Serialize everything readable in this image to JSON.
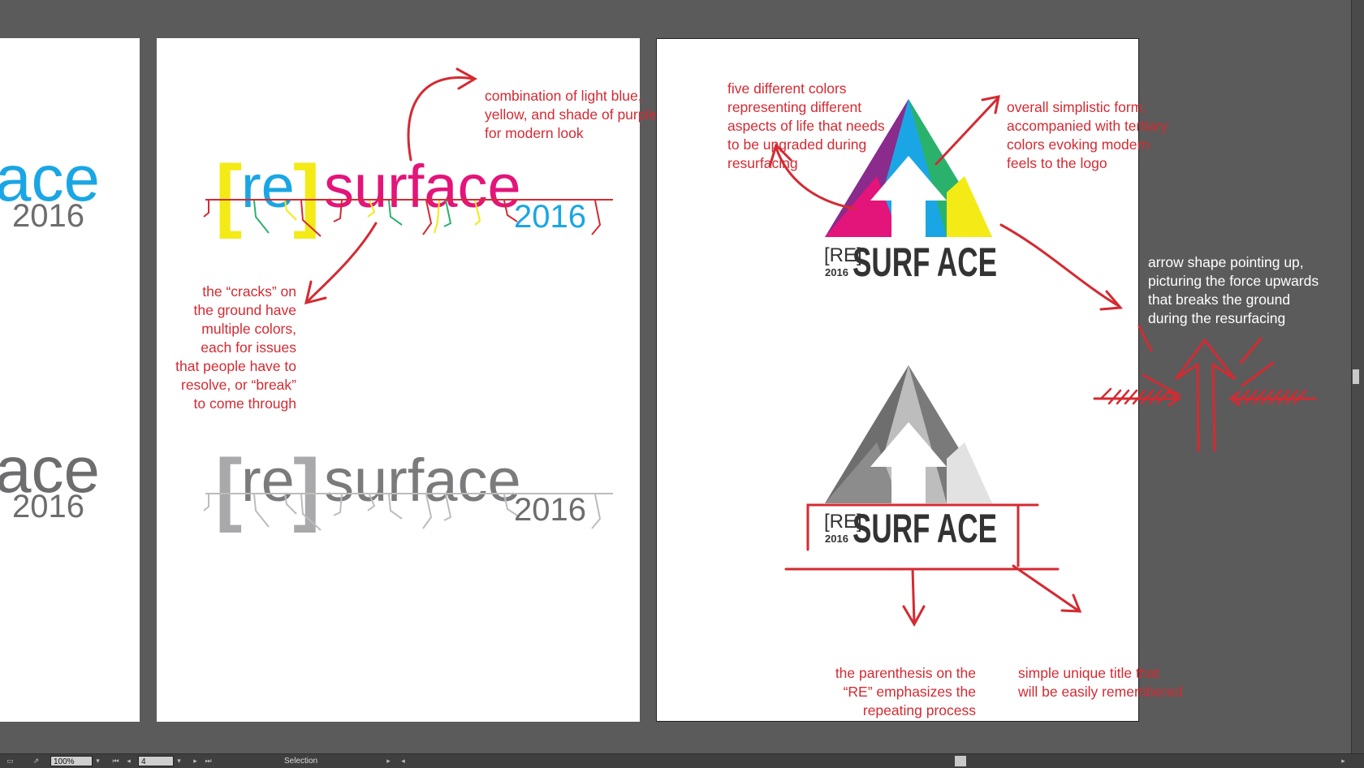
{
  "artboard1": {
    "word_partial": "ace",
    "year_top": "2016",
    "year_bottom": "2016"
  },
  "artboard2": {
    "logo_color": {
      "bracket_left": "[",
      "re": "re",
      "bracket_right": "]",
      "surface": "surface",
      "year": "2016"
    },
    "logo_gray": {
      "bracket_left": "[",
      "re": "re",
      "bracket_right": "]",
      "surface": "surface",
      "year": "2016"
    },
    "note_colors": [
      "combination of light blue,",
      "yellow, and shade of purple",
      "for modern look"
    ],
    "note_cracks": [
      "the “cracks” on",
      "the ground have",
      "multiple colors,",
      "each for issues",
      "that people have to",
      "resolve, or “break”",
      "to come through"
    ]
  },
  "artboard3": {
    "logo_color": {
      "re": "[RE]",
      "year": "2016",
      "title": "SURF ACE"
    },
    "logo_gray": {
      "re": "[RE]",
      "year": "2016",
      "title": "SURF ACE"
    },
    "note_five": [
      "five different colors",
      "representing different",
      "aspects of life that needs",
      "to be upgraded during",
      "resurfacing"
    ],
    "note_form": [
      "overall simplistic form,",
      "accompanied with tertiary",
      "colors evoking modern",
      "feels to the logo"
    ],
    "note_paren": [
      "the parenthesis on the",
      "“RE” emphasizes the",
      "repeating process"
    ],
    "note_title": [
      "simple unique title that",
      "will be easily remembered"
    ]
  },
  "note_arrow": [
    "arrow shape pointing up,",
    "picturing the force upwards",
    "that breaks the ground",
    "during the resurfacing"
  ],
  "statusbar": {
    "zoom": "100%",
    "page": "4",
    "tool": "Selection"
  },
  "colors": {
    "cyan": "#1aa6e4",
    "yellow": "#f3ea16",
    "magenta": "#e3147a",
    "purple": "#8b2b8c",
    "green": "#2ab26c",
    "red": "#d42a32"
  }
}
